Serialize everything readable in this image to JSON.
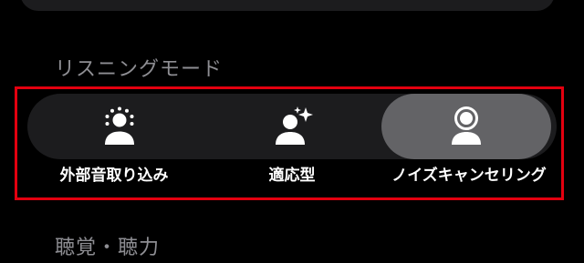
{
  "listening_mode": {
    "heading": "リスニングモード",
    "selected_index": 2,
    "options": [
      {
        "label": "外部音取り込み",
        "icon": "person-transparency-icon",
        "selected": false
      },
      {
        "label": "適応型",
        "icon": "person-sparkle-icon",
        "selected": false
      },
      {
        "label": "ノイズキャンセリング",
        "icon": "person-noise-cancel-icon",
        "selected": true
      }
    ]
  },
  "hearing_section": {
    "heading": "聴覚・聴力"
  },
  "colors": {
    "background": "#000000",
    "segment_track": "#1c1c1e",
    "segment_selected": "#636366",
    "heading_text": "#8e8e93",
    "label_text": "#ffffff",
    "highlight_border": "#e3000f"
  }
}
